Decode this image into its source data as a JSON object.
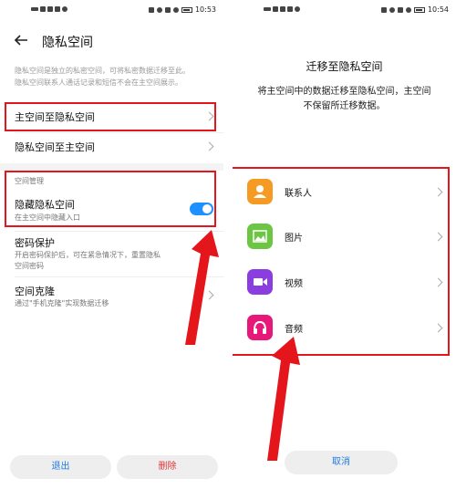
{
  "left_screen": {
    "time": "10:53",
    "title": "隐私空间",
    "description_line1": "隐私空间是独立的私密空间，可将私密数据迁移至此。",
    "description_line2": "隐私空间联系人通话记录和短信不会在主空间展示。",
    "row_main_to_private": "主空间至隐私空间",
    "row_private_to_main": "隐私空间至主空间",
    "section_title": "空间管理",
    "hide_label": "隐藏隐私空间",
    "hide_sub": "在主空间中隐藏入口",
    "hide_toggle_on": true,
    "password_label": "密码保护",
    "password_sub1": "开启密码保护后，可在紧急情况下，重置隐私",
    "password_sub2": "空间密码",
    "clone_label": "空间克隆",
    "clone_sub": "通过\"手机克隆\"实现数据迁移",
    "exit_button": "退出",
    "delete_button": "删除"
  },
  "right_screen": {
    "time": "10:54",
    "title": "迁移至隐私空间",
    "desc_line1": "将主空间中的数据迁移至隐私空间，主空间",
    "desc_line2": "不保留所迁移数据。",
    "items": [
      {
        "label": "联系人",
        "icon": "contacts-icon",
        "color": "#f59a23"
      },
      {
        "label": "图片",
        "icon": "gallery-icon",
        "color": "#6cc644"
      },
      {
        "label": "视频",
        "icon": "video-icon",
        "color": "#8a3ee0"
      },
      {
        "label": "音频",
        "icon": "audio-icon",
        "color": "#e6197a"
      }
    ],
    "cancel_button": "取消"
  },
  "colors": {
    "accent": "#1e7be0",
    "danger": "#e23535",
    "highlight_box": "#e4161b",
    "toggle_on": "#1e90ff"
  }
}
